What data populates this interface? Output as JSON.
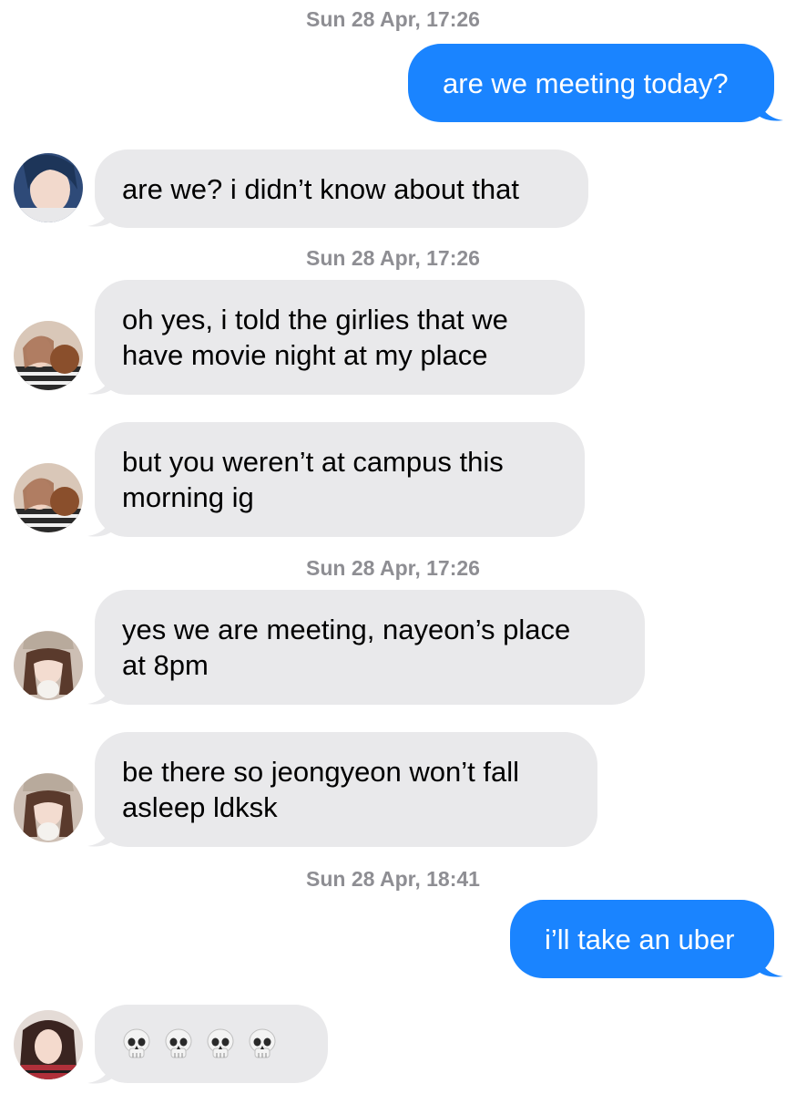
{
  "timestamps": [
    "Sun 28 Apr, 17:26",
    "Sun 28 Apr, 17:26",
    "Sun 28 Apr, 17:26",
    "Sun 28 Apr, 18:41"
  ],
  "messages": [
    {
      "from": "me",
      "text": "are we meeting today?"
    },
    {
      "from": "them",
      "text": "are we? i didn’t know about that"
    },
    {
      "from": "them",
      "text": "oh yes, i told the girlies that we\nhave movie night at my place"
    },
    {
      "from": "them",
      "text": "but you weren’t at campus this\nmorning ig"
    },
    {
      "from": "them",
      "text": "yes we are meeting, nayeon’s place\nat 8pm"
    },
    {
      "from": "them",
      "text": "be there so jeongyeon won’t fall\nasleep ldksk"
    },
    {
      "from": "me",
      "text": "i’ll take an uber"
    },
    {
      "from": "them",
      "emoji": [
        "skull-emoji",
        "skull-emoji",
        "skull-emoji",
        "skull-emoji"
      ]
    }
  ],
  "colors": {
    "outgoing_bubble": "#1a84ff",
    "incoming_bubble": "#e9e9eb",
    "timestamp": "#8e8e93"
  }
}
